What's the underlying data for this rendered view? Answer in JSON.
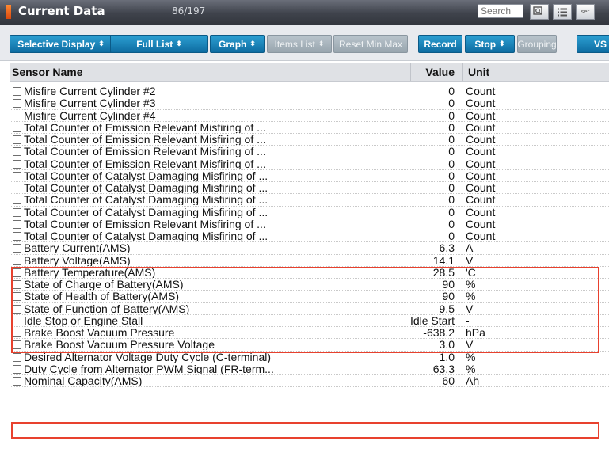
{
  "titlebar": {
    "title": "Current Data",
    "count": "86/197",
    "search_placeholder": "Search",
    "settings_icon_text": "set"
  },
  "toolbar": {
    "buttons": [
      {
        "label": "Selective Display",
        "dropdown": true,
        "enabled": true
      },
      {
        "label": "Full List",
        "dropdown": true,
        "enabled": true
      },
      {
        "label": "Graph",
        "dropdown": true,
        "enabled": true
      },
      {
        "label": "Items List",
        "dropdown": true,
        "enabled": false
      },
      {
        "label": "Reset Min.Max",
        "dropdown": false,
        "enabled": false
      },
      {
        "label": "Record",
        "dropdown": false,
        "enabled": true
      },
      {
        "label": "Stop",
        "dropdown": true,
        "enabled": true
      },
      {
        "label": "Grouping",
        "dropdown": false,
        "enabled": false
      },
      {
        "label": "VS",
        "dropdown": false,
        "enabled": true
      }
    ]
  },
  "table": {
    "headers": {
      "sensor": "Sensor Name",
      "value": "Value",
      "unit": "Unit"
    },
    "rows": [
      {
        "name": "Misfire Current Cylinder #2",
        "value": "0",
        "unit": "Count"
      },
      {
        "name": "Misfire Current Cylinder #3",
        "value": "0",
        "unit": "Count"
      },
      {
        "name": "Misfire Current Cylinder #4",
        "value": "0",
        "unit": "Count"
      },
      {
        "name": "Total Counter of Emission Relevant Misfiring of ...",
        "value": "0",
        "unit": "Count"
      },
      {
        "name": "Total Counter of Emission Relevant Misfiring of ...",
        "value": "0",
        "unit": "Count"
      },
      {
        "name": "Total Counter of Emission Relevant Misfiring of ...",
        "value": "0",
        "unit": "Count"
      },
      {
        "name": "Total Counter of Emission Relevant Misfiring of ...",
        "value": "0",
        "unit": "Count"
      },
      {
        "name": "Total Counter of Catalyst Damaging Misfiring of ...",
        "value": "0",
        "unit": "Count"
      },
      {
        "name": "Total Counter of Catalyst Damaging Misfiring of ...",
        "value": "0",
        "unit": "Count"
      },
      {
        "name": "Total Counter of Catalyst Damaging Misfiring of ...",
        "value": "0",
        "unit": "Count"
      },
      {
        "name": "Total Counter of Catalyst Damaging Misfiring of ...",
        "value": "0",
        "unit": "Count"
      },
      {
        "name": "Total Counter of Emission Relevant Misfiring of ...",
        "value": "0",
        "unit": "Count"
      },
      {
        "name": "Total Counter of Catalyst Damaging Misfiring of ...",
        "value": "0",
        "unit": "Count"
      },
      {
        "name": "Battery Current(AMS)",
        "value": "6.3",
        "unit": "A"
      },
      {
        "name": "Battery Voltage(AMS)",
        "value": "14.1",
        "unit": "V"
      },
      {
        "name": "Battery Temperature(AMS)",
        "value": "28.5",
        "unit": "'C"
      },
      {
        "name": "State of Charge of Battery(AMS)",
        "value": "90",
        "unit": "%"
      },
      {
        "name": "State of Health of Battery(AMS)",
        "value": "90",
        "unit": "%"
      },
      {
        "name": "State of Function of Battery(AMS)",
        "value": "9.5",
        "unit": "V"
      },
      {
        "name": "Idle Stop or Engine Stall",
        "value": "Idle Start",
        "unit": "-"
      },
      {
        "name": "Brake Boost Vacuum Pressure",
        "value": "-638.2",
        "unit": "hPa"
      },
      {
        "name": "Brake Boost Vacuum Pressure Voltage",
        "value": "3.0",
        "unit": "V"
      },
      {
        "name": "Desired Alternator Voltage Duty Cycle (C-terminal)",
        "value": "1.0",
        "unit": "%"
      },
      {
        "name": "Duty Cycle from Alternator PWM Signal (FR-term...",
        "value": "63.3",
        "unit": "%"
      },
      {
        "name": "Nominal Capacity(AMS)",
        "value": "60",
        "unit": "Ah"
      }
    ]
  },
  "colors": {
    "accent": "#1a86bd",
    "highlight": "#e8412e",
    "titlebar": "#3f434c",
    "marker": "#f26b1d"
  }
}
